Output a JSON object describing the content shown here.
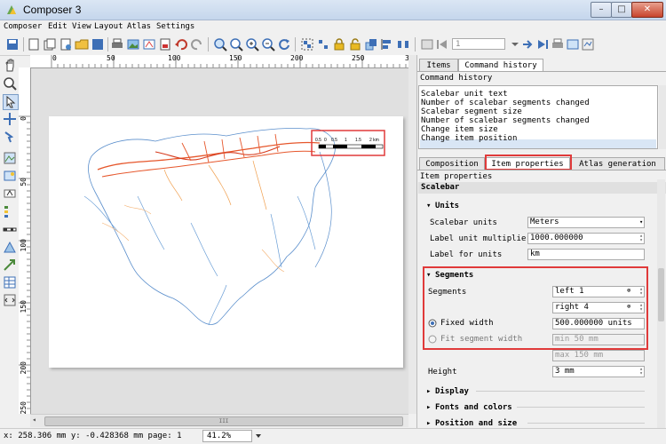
{
  "window": {
    "title": "Composer 3",
    "min": "–",
    "max": "□",
    "close": "✕"
  },
  "menu": [
    "Composer",
    "Edit",
    "View",
    "Layout",
    "Atlas",
    "Settings"
  ],
  "toolbar": {
    "atlas_page_value": "1"
  },
  "ruler": {
    "h_ticks": [
      "0",
      "50",
      "100",
      "150",
      "200",
      "250",
      "3"
    ],
    "v_ticks": [
      "0",
      "50",
      "100",
      "150",
      "200",
      "250"
    ]
  },
  "scalebar": {
    "labels": [
      "0.5",
      "0",
      "0.5",
      "1",
      "1.5",
      "2 km"
    ]
  },
  "hscroll": {
    "handle": "III"
  },
  "status": {
    "coords": "x: 258.306 mm y: -0.428368 mm page: 1",
    "zoom": "41.2%"
  },
  "panel": {
    "top_tabs": [
      "Items",
      "Command history"
    ],
    "history_title": "Command history",
    "history": [
      "Scalebar unit text",
      "Number of scalebar segments changed",
      "Scalebar segment size",
      "Number of scalebar segments changed",
      "Change item size",
      "Change item position"
    ],
    "bottom_tabs": [
      "Composition",
      "Item properties",
      "Atlas generation"
    ],
    "item_properties_title": "Item properties",
    "item_type": "Scalebar",
    "units": {
      "section": "Units",
      "scalebar_units_label": "Scalebar units",
      "scalebar_units_value": "Meters",
      "multiplier_label": "Label unit multiplier",
      "multiplier_value": "1000.000000",
      "label_units_label": "Label for units",
      "label_units_value": "km"
    },
    "segments": {
      "section": "Segments",
      "segments_label": "Segments",
      "left_value": "left 1",
      "right_value": "right 4",
      "fixed_width_label": "Fixed width",
      "fixed_width_value": "500.000000 units",
      "fit_label": "Fit segment width",
      "min_value": "min 50 mm",
      "max_value": "max 150 mm"
    },
    "height_label": "Height",
    "height_value": "3 mm",
    "collapsed_sections": [
      "Display",
      "Fonts and colors",
      "Position and size"
    ]
  }
}
